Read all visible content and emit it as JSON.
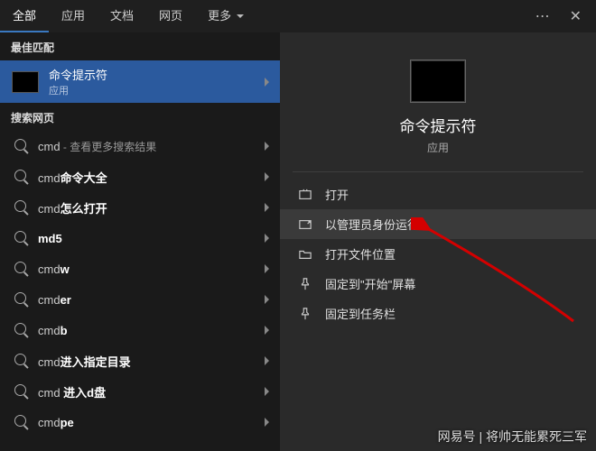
{
  "tabs": {
    "all": "全部",
    "apps": "应用",
    "docs": "文档",
    "web": "网页",
    "more": "更多"
  },
  "left": {
    "best_match": "最佳匹配",
    "app_name": "命令提示符",
    "app_type": "应用",
    "search_web": "搜索网页",
    "rows": [
      {
        "prefix": "cmd",
        "bold": "",
        "suffix": " - 查看更多搜索结果"
      },
      {
        "prefix": "cmd",
        "bold": "命令大全",
        "suffix": ""
      },
      {
        "prefix": "cmd",
        "bold": "怎么打开",
        "suffix": ""
      },
      {
        "prefix": "",
        "bold": "md5",
        "suffix": ""
      },
      {
        "prefix": "cmd",
        "bold": "w",
        "suffix": ""
      },
      {
        "prefix": "cmd",
        "bold": "er",
        "suffix": ""
      },
      {
        "prefix": "cmd",
        "bold": "b",
        "suffix": ""
      },
      {
        "prefix": "cmd",
        "bold": "进入指定目录",
        "suffix": ""
      },
      {
        "prefix": "cmd ",
        "bold": "进入d盘",
        "suffix": ""
      },
      {
        "prefix": "cmd",
        "bold": "pe",
        "suffix": ""
      }
    ]
  },
  "right": {
    "title": "命令提示符",
    "subtitle": "应用",
    "actions": {
      "open": "打开",
      "run_admin": "以管理员身份运行",
      "open_location": "打开文件位置",
      "pin_start": "固定到\"开始\"屏幕",
      "pin_taskbar": "固定到任务栏"
    }
  },
  "watermark": "网易号 | 将帅无能累死三军"
}
